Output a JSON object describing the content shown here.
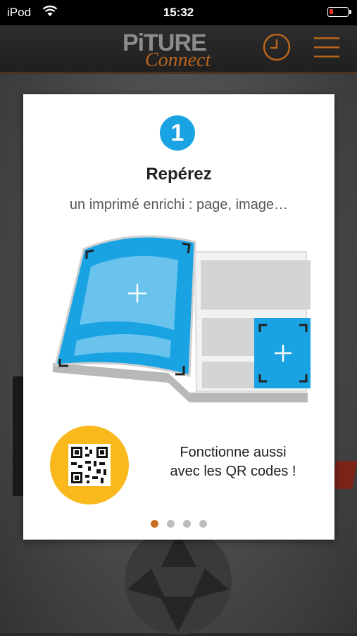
{
  "status_bar": {
    "carrier": "iPod",
    "time": "15:32",
    "battery_level": 0.2
  },
  "header": {
    "logo_word1": "PiTURE",
    "logo_word2": "Connect",
    "history_icon": "clock-icon",
    "menu_icon": "hamburger-icon"
  },
  "onboarding": {
    "step_number": "1",
    "title": "Repérez",
    "subtitle": "un imprimé enrichi : page, image…",
    "illustration_icon": "magazine-illustration",
    "qr_icon": "qr-code-icon",
    "qr_line1": "Fonctionne aussi",
    "qr_line2": "avec les QR codes !",
    "pages": 4,
    "current_page": 1
  },
  "colors": {
    "accent_blue": "#1aa3e3",
    "qr_yellow": "#f9b81c",
    "active_dot": "#c96d22",
    "inactive_dot": "#bdbdbd",
    "brand_orange": "#b8651c"
  }
}
